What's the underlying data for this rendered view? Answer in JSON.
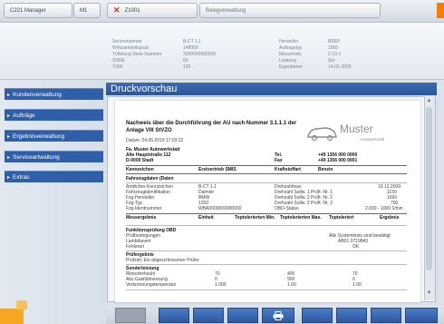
{
  "tabs": [
    {
      "label": "C221 Manager",
      "suffix": "M1"
    },
    {
      "label": "Z1001"
    },
    {
      "label": "Belegverwaltung"
    }
  ],
  "info": {
    "left": [
      {
        "label": "Seriennummer",
        "value": "B-CT 1.1"
      },
      {
        "label": "Wirksamkeitsgrad",
        "value": "148000"
      },
      {
        "label": "Tüftelung Serie Nummer",
        "value": "3930000000000"
      },
      {
        "label": "SNNE",
        "value": "60"
      },
      {
        "label": "T300",
        "value": "120"
      }
    ],
    "right": [
      {
        "label": "Hersteller",
        "value": "BREP"
      },
      {
        "label": "Auftragstyp",
        "value": "1950"
      },
      {
        "label": "Messmodo",
        "value": "2-13-1"
      },
      {
        "label": "Leistung",
        "value": "Sm"
      },
      {
        "label": "Eigentümer",
        "value": "14-01-2009"
      }
    ]
  },
  "sidebar": {
    "items": [
      {
        "label": "Kundenverwaltung"
      },
      {
        "label": "Aufträge"
      },
      {
        "label": "Ergebnisverwaltung"
      },
      {
        "label": "Serviceartwaltung"
      },
      {
        "label": "Extras"
      }
    ]
  },
  "main": {
    "title": "Druckvorschau"
  },
  "document": {
    "heading_line1": "Nachweis über die Durchführung der AU nach Nummer 3.1.1.1 der",
    "heading_line2": "Anlage VIII StVZO",
    "date_line": "Datum: 24.06.2010 17:03:22",
    "logo_name": "Muster",
    "logo_sub": "Autowerkstatt",
    "company": "Fa. Muster Autowerkstatt",
    "street": "Alte Hauptstraße 112",
    "city": "D-0000  Stadt",
    "tel_label": "Tel.",
    "tel": "+49 1356 000 0000",
    "fax_label": "Fax",
    "fax": "+49 1356 000 0001",
    "row_headers": [
      "Kennzeichen",
      "Erstvertrieb SMIS",
      "Kraftstoffart",
      "Benzin"
    ],
    "section1": "Fahrzeugdaten (Daten",
    "section1_rows": [
      [
        "Amtliches Kennzeichen",
        "B-CT 1.1",
        "Drehzahlmax.",
        "19.12.2009"
      ],
      [
        "Fahrzeugidentifikation",
        "Daimler",
        "Drehzahl Sollw. 1 Prüft. Nr. 1",
        "1150"
      ],
      [
        "Fzg-Hersteller",
        "BMW",
        "Drehzahl Sollw. 2 Prüft. Nr. 2",
        "1660"
      ],
      [
        "Fzg-Typ",
        "1250",
        "Drehzahl Sollw. 3 Prüft. Nr. 3",
        "700"
      ],
      [
        "Fzg-Identnummer",
        "WBA0000000000000",
        "OBD-Status",
        "2.000 - 1000 1/min"
      ]
    ],
    "measure_headers": [
      "Messergebnis",
      "Einheit",
      "Toptolerierten Min.",
      "Toptolerierten Max.",
      "Toptoleriert",
      "Ergebnis"
    ],
    "section2": "Funktionsprüfung OBD",
    "section2_rows": [
      [
        "Prüfbedingungen",
        "",
        "Alle Systemtests sind bestätigt"
      ],
      [
        "Lambdawert",
        "",
        "AB01 0719843"
      ],
      [
        "Fehlerart",
        "",
        "OK"
      ]
    ],
    "section3": "Prüfergebnis",
    "section3_text": "Prüfziel: Ein abgeschlossener Prüfer",
    "section4": "Sonderleistung",
    "section4_rows": [
      [
        "Motordrehzahl",
        "70",
        "400",
        "70"
      ],
      [
        "Abs.Gasfüllmessung",
        "0",
        "900",
        "0"
      ],
      [
        "Verbrennungstemperatur",
        "1.000",
        "1.60",
        "1.00"
      ]
    ]
  },
  "toolbar": {
    "print_icon": "printer-icon"
  }
}
